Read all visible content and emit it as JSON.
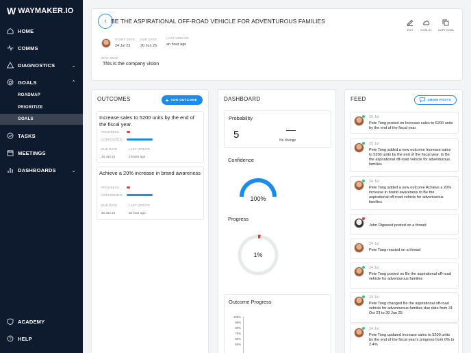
{
  "sidebar": {
    "logo_mark": "W",
    "logo_word": "WAYMAKER.IO",
    "items": [
      {
        "label": "HOME",
        "icon": "home-icon"
      },
      {
        "label": "COMMS",
        "icon": "pulse-icon"
      },
      {
        "label": "DIAGNOSTICS",
        "icon": "triangle-icon"
      },
      {
        "label": "GOALS",
        "icon": "target-icon"
      },
      {
        "label": "TASKS",
        "icon": "check-icon"
      },
      {
        "label": "MEETINGS",
        "icon": "calendar-icon"
      },
      {
        "label": "DASHBOARDS",
        "icon": "bar-chart-icon"
      }
    ],
    "goals_sub": [
      "ROADMAP",
      "PRIORITIZE",
      "GOALS"
    ],
    "bottom": [
      {
        "label": "ACADEMY",
        "icon": "shield-icon"
      },
      {
        "label": "HELP",
        "icon": "help-icon"
      }
    ]
  },
  "header": {
    "title": "BE THE ASPIRATIONAL OFF-ROAD VEHICLE FOR ADVENTUROUS FAMILIES",
    "actions": [
      {
        "label": "EDIT",
        "icon": "edit-icon"
      },
      {
        "label": "GOAL AI",
        "icon": "cloud-icon"
      },
      {
        "label": "COPY GOAL",
        "icon": "copy-icon"
      }
    ],
    "start_date_label": "START DATE",
    "start_date": "24 Jul 23",
    "due_date_label": "DUE DATE",
    "due_date": "30 Jun 25",
    "last_update_label": "LAST UPDATE",
    "last_update": "an hour ago",
    "why_now_label": "WHY NOW",
    "why_now": "This is the company vision"
  },
  "outcomes": {
    "title": "OUTCOMES",
    "add_label": "ADD OUTCOME",
    "progress_label": "PROGRESS",
    "confidence_label": "CONFIDENCE",
    "due_label": "DUE DATE",
    "update_label": "LAST UPDATE",
    "items": [
      {
        "title": "Increase sales to 5200 units by the end of the fiscal year.",
        "progress": 0.12,
        "confidence": 1.0,
        "due": "30 Jun 24",
        "updated": "2 hours ago"
      },
      {
        "title": "Achieve a 20% increase in brand awareness",
        "progress": 0.12,
        "confidence": 1.0,
        "due": "30 Jun 24",
        "updated": "an hour ago"
      }
    ]
  },
  "dashboard": {
    "title": "DASHBOARD",
    "probability_label": "Probability",
    "probability_value": "5",
    "change_symbol": "—",
    "change_label": "No change",
    "confidence_label": "Confidence",
    "confidence_value": "100%",
    "confidence_fraction": 1.0,
    "progress_label": "Progress",
    "progress_value": "1%",
    "progress_fraction": 0.01,
    "outcome_progress_label": "Outcome Progress",
    "outcome_ticks": [
      "100%",
      "90%",
      "80%",
      "70%",
      "60%",
      "50%"
    ]
  },
  "feed": {
    "title": "FEED",
    "show_posts_label": "SHOW POSTS",
    "items": [
      {
        "date": "25 Jul",
        "text": "Pete Tong posted on Increase sales to 5200 units by the end of the fiscal year."
      },
      {
        "date": "25 Jul",
        "text": "Pete Tong added a new outcome Increase sales to 5200 units by the end of the fiscal year. to Be the aspirational off-road vehicle for adventurous families"
      },
      {
        "date": "24 Jul",
        "text": "Pete Tong added a new outcome Achieve a 20% increase in brand awareness to Be the aspirational off-road vehicle for adventurous families"
      },
      {
        "date": "",
        "text": "John Digweed posted on a thread"
      },
      {
        "date": "24 Jul",
        "text": "Pete Tong reacted on a thread"
      },
      {
        "date": "24 Jul",
        "text": "Pete Tong posted on Be the aspirational off-road vehicle for adventurous families"
      },
      {
        "date": "24 Jul",
        "text": "Pete Tong changed Be the aspirational off-road vehicle for adventurous families due date from 31 Oct 23 to 30 Jun 25"
      },
      {
        "date": "24 Jul",
        "text": "Pete Tong updated Increase sales to 5200 units by the end of the fiscal year's progress from 0% to 2.4%"
      }
    ]
  },
  "colors": {
    "sidebar_bg": "#0e1b2e",
    "accent": "#1f8be8",
    "progress_red": "#e53935",
    "online_green": "#2ecc71"
  }
}
